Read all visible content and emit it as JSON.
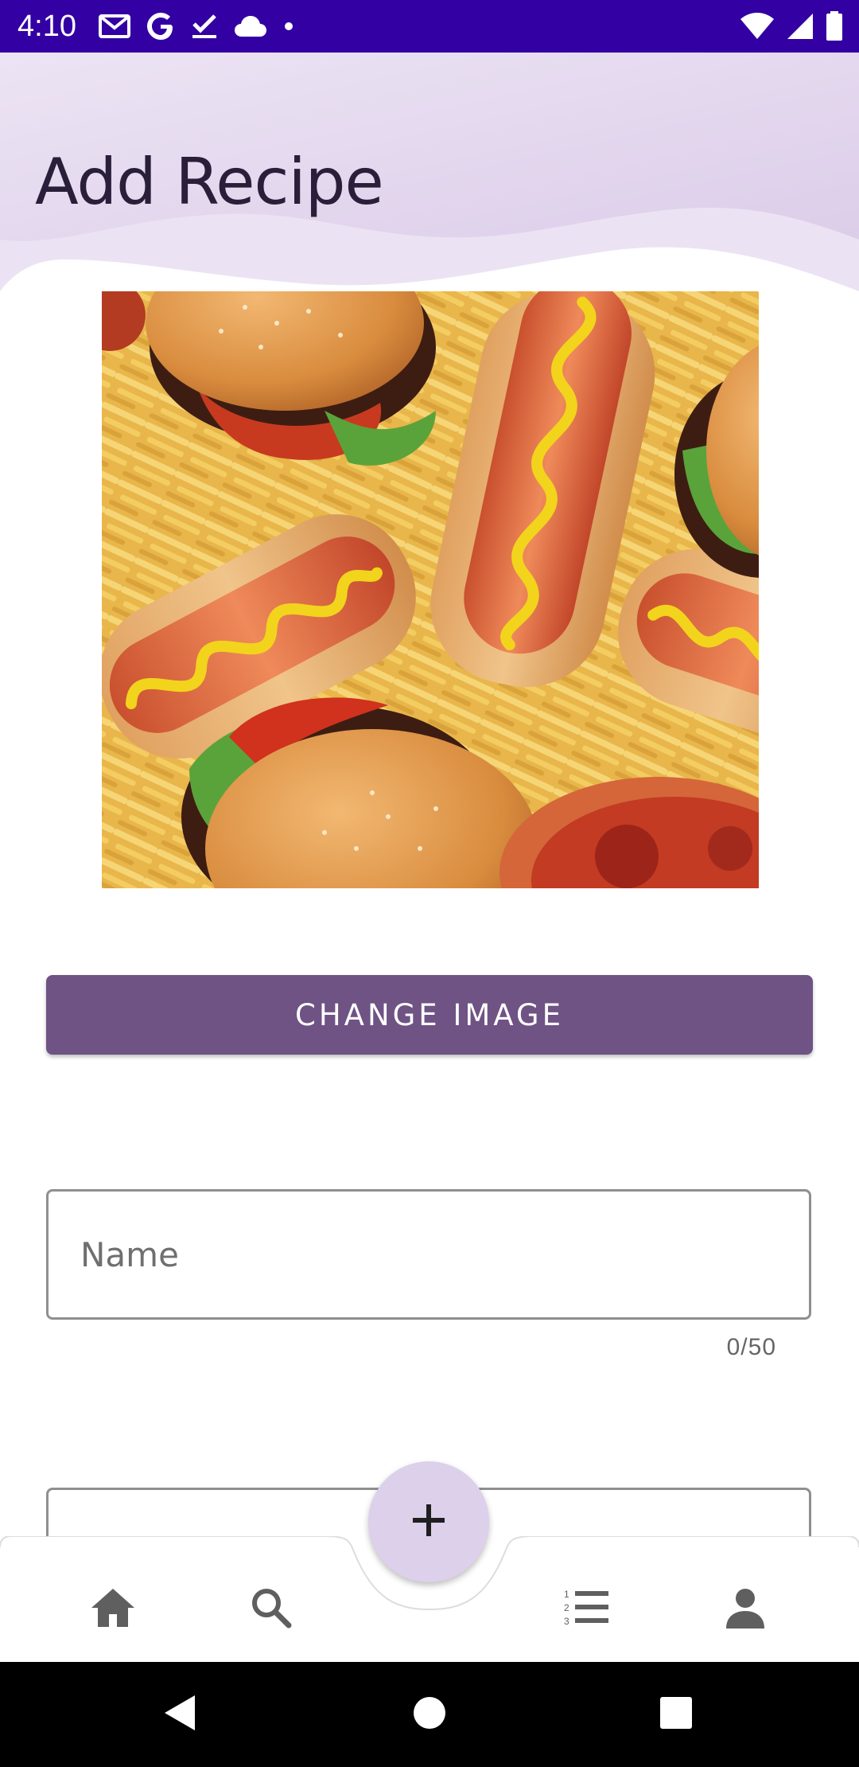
{
  "status_bar": {
    "time": "4:10",
    "left_icons": [
      "gmail-icon",
      "google-icon",
      "task-check-icon",
      "cloud-icon",
      "dot-icon"
    ],
    "right_icons": [
      "wifi-icon",
      "signal-icon",
      "battery-icon"
    ]
  },
  "header": {
    "title": "Add Recipe"
  },
  "recipe_image": {
    "description_icon": "food-photo"
  },
  "change_image_button": {
    "label": "CHANGE IMAGE"
  },
  "name_field": {
    "placeholder": "Name",
    "value": "",
    "counter": "0/50"
  },
  "bottom_nav": {
    "items": [
      "home-icon",
      "search-icon",
      "list-icon",
      "profile-icon"
    ],
    "fab_icon": "plus-icon"
  },
  "system_nav": {
    "buttons": [
      "back",
      "home",
      "recents"
    ]
  },
  "colors": {
    "status_bar": "#3300a3",
    "button": "#6e5384",
    "fab": "#dcd0eb",
    "header_wave": "#e3d8ef"
  }
}
